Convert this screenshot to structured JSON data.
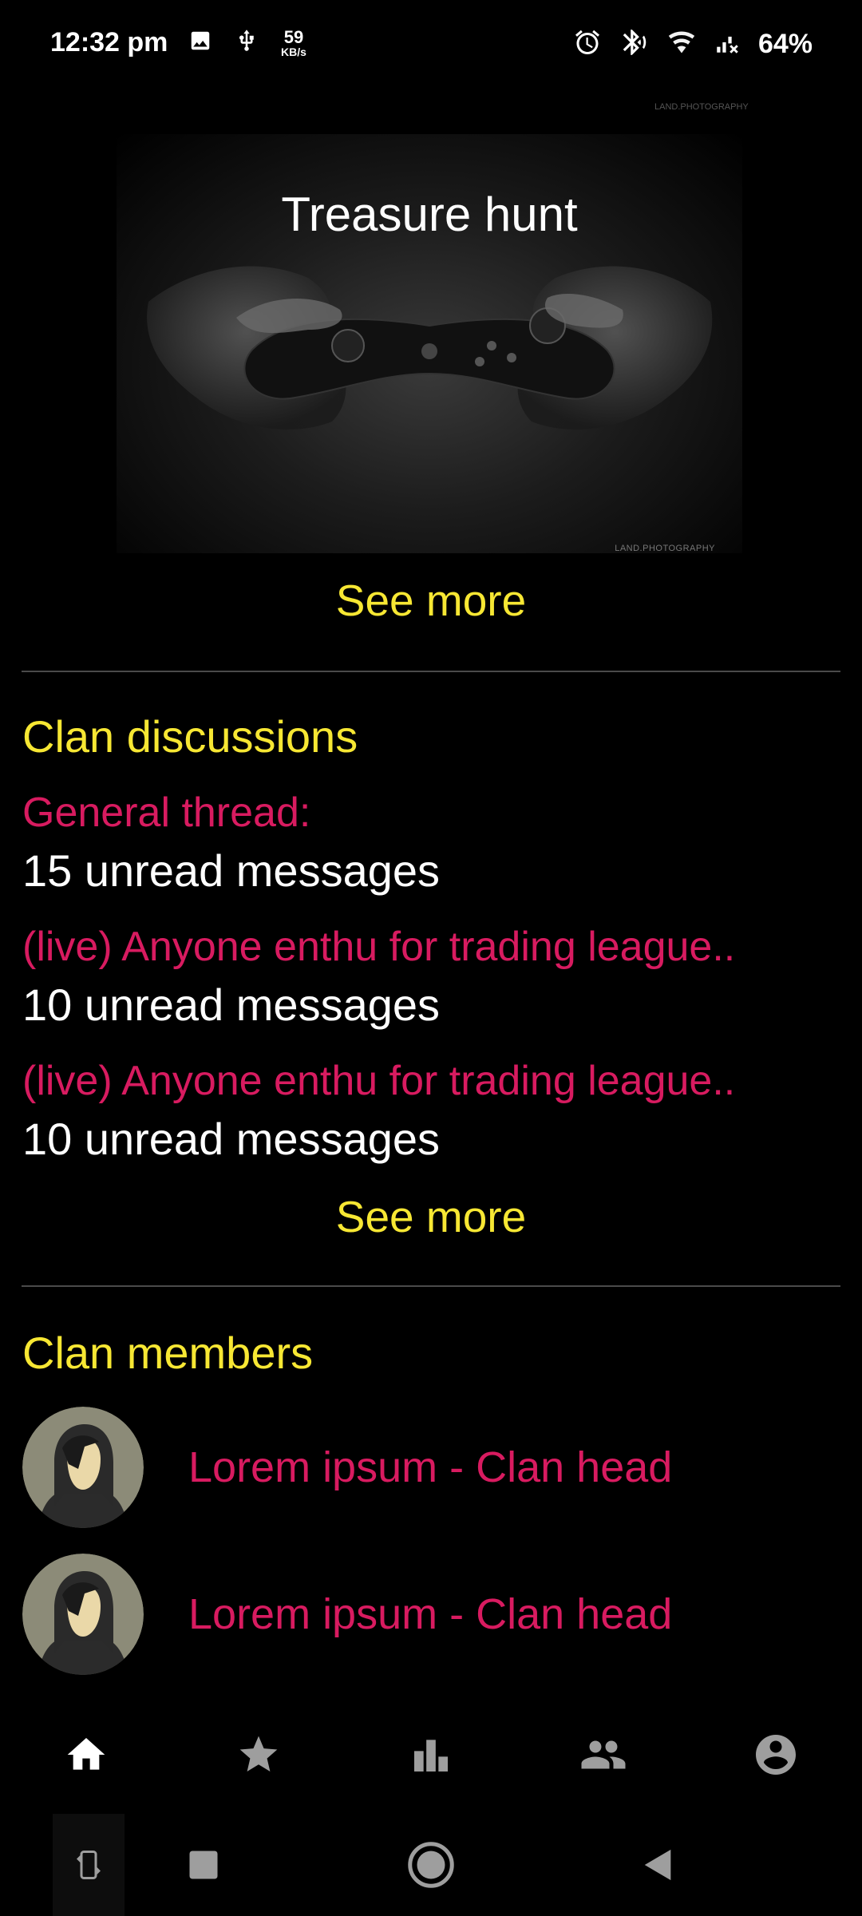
{
  "status_bar": {
    "time": "12:32 pm",
    "speed_value": "59",
    "speed_unit": "KB/s",
    "battery": "64%",
    "icons": [
      "image-icon",
      "usb-icon",
      "alarm-icon",
      "bluetooth-icon",
      "wifi-icon",
      "signal-icon"
    ]
  },
  "hero": {
    "title": "Treasure hunt",
    "watermark": "LAND.PHOTOGRAPHY",
    "see_more": "See more"
  },
  "discussions": {
    "title": "Clan discussions",
    "threads": [
      {
        "title": "General thread:",
        "count": "15 unread messages"
      },
      {
        "title": "(live) Anyone enthu for trading league..",
        "count": "10 unread messages"
      },
      {
        "title": "(live) Anyone enthu for trading league..",
        "count": "10 unread messages"
      }
    ],
    "see_more": "See more"
  },
  "members": {
    "title": "Clan members",
    "list": [
      {
        "name": "Lorem ipsum - Clan head"
      },
      {
        "name": "Lorem ipsum - Clan head"
      }
    ]
  },
  "bottom_nav": {
    "items": [
      "home-icon",
      "star-icon",
      "leaderboard-icon",
      "group-icon",
      "account-icon"
    ],
    "active": "home-icon"
  },
  "system_nav": {
    "items": [
      "rotate-icon",
      "recents-icon",
      "home-circle-icon",
      "back-icon"
    ]
  },
  "colors": {
    "accent_yellow": "#f7e733",
    "accent_pink": "#d81b60",
    "background": "#000000"
  }
}
